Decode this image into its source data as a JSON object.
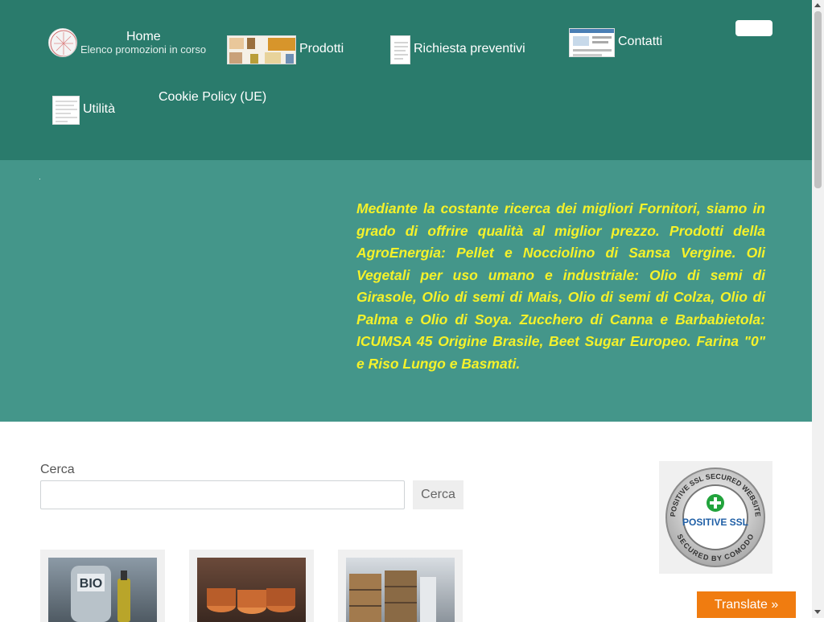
{
  "nav": {
    "home": {
      "label": "Home",
      "sublabel": "Elenco promozioni in corso"
    },
    "prodotti": {
      "label": "Prodotti",
      "chevron": ""
    },
    "preventivi": {
      "label": "Richiesta preventivi",
      "chevron": ""
    },
    "contatti": {
      "label": "Contatti",
      "chevron": ""
    },
    "utilita": {
      "label": "Utilità",
      "chevron": ""
    },
    "cookie": {
      "label": "Cookie Policy (UE)"
    }
  },
  "hero": {
    "text": "Mediante la costante ricerca dei migliori Fornitori, siamo in grado di offrire qualità al miglior prezzo. Prodotti della AgroEnergia: Pellet e Nocciolino di Sansa Vergine. Oli Vegetali per uso umano e industriale: Olio di semi di Girasole, Olio di semi di Mais, Olio di semi di Colza, Olio di Palma e Olio di Soya. Zucchero di Canna e Barbabietola: ICUMSA 45 Origine Brasile, Beet Sugar Europeo. Farina \"0\" e Riso Lungo e Basmati."
  },
  "search": {
    "label": "Cerca",
    "placeholder": "",
    "button": "Cerca"
  },
  "ssl_badge": {
    "top": "POSITIVE SSL SECURED WEBSITE",
    "center": "POSITIVE SSL",
    "bottom": "SECURED BY COMODO"
  },
  "cards": [
    {
      "image": "bio-oil-tanks-image",
      "text": "BIO"
    },
    {
      "image": "copper-rolls-image"
    },
    {
      "image": "warehouse-pallets-image"
    }
  ],
  "translate": {
    "label": "Translate »"
  },
  "colors": {
    "header": "#2a7b6c",
    "hero": "#44968a",
    "hero_text": "#f5f22a",
    "translate": "#f07c10"
  }
}
